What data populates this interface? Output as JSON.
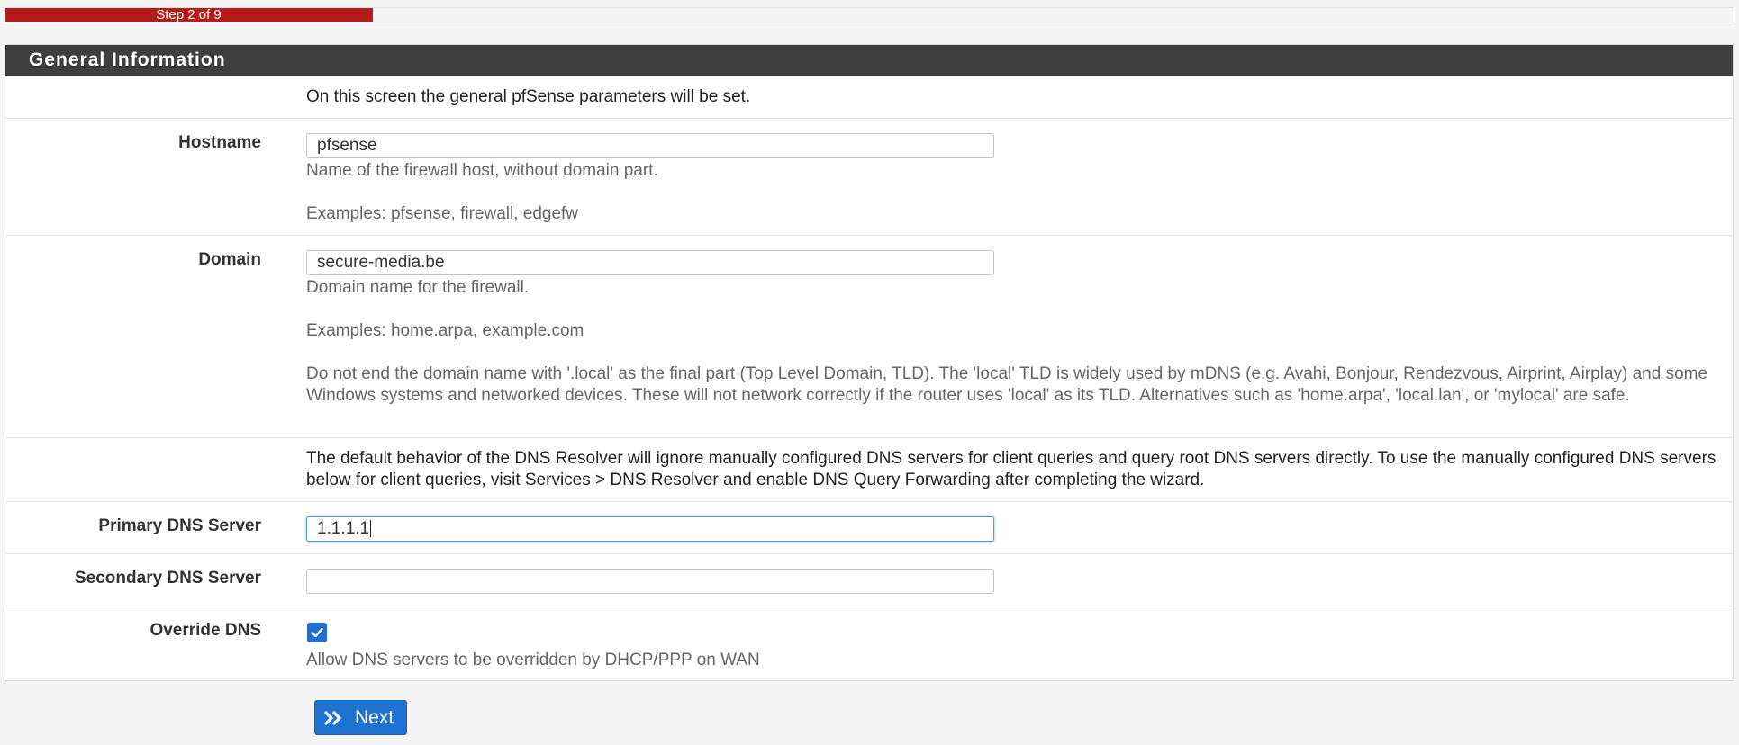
{
  "progress": {
    "label": "Step 2 of 9",
    "fraction": 0.222
  },
  "panel": {
    "title": "General Information",
    "intro": "On this screen the general pfSense parameters will be set."
  },
  "hostname": {
    "label": "Hostname",
    "value": "pfsense",
    "help1": "Name of the firewall host, without domain part.",
    "help2": "Examples: pfsense, firewall, edgefw"
  },
  "domain": {
    "label": "Domain",
    "value": "secure-media.be",
    "help1": "Domain name for the firewall.",
    "help2": "Examples: home.arpa, example.com",
    "help3": "Do not end the domain name with '.local' as the final part (Top Level Domain, TLD). The 'local' TLD is widely used by mDNS (e.g. Avahi, Bonjour, Rendezvous, Airprint, Airplay) and some Windows systems and networked devices. These will not network correctly if the router uses 'local' as its TLD. Alternatives such as 'home.arpa', 'local.lan', or 'mylocal' are safe."
  },
  "dns_note": "The default behavior of the DNS Resolver will ignore manually configured DNS servers for client queries and query root DNS servers directly. To use the manually configured DNS servers below for client queries, visit Services > DNS Resolver and enable DNS Query Forwarding after completing the wizard.",
  "primary_dns": {
    "label": "Primary DNS Server",
    "value": "1.1.1.1"
  },
  "secondary_dns": {
    "label": "Secondary DNS Server",
    "value": ""
  },
  "override_dns": {
    "label": "Override DNS",
    "checked": true,
    "help": "Allow DNS servers to be overridden by DHCP/PPP on WAN"
  },
  "next_button": {
    "label": "Next",
    "icon": "double-chevron-right-icon"
  },
  "colors": {
    "progress": "#b71c1c",
    "heading_bg": "#3e3e3e",
    "button": "#1e73d2"
  }
}
